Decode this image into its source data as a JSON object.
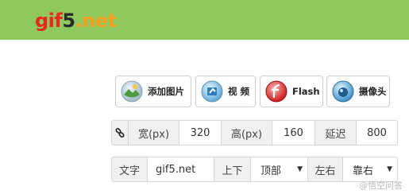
{
  "site": {
    "logo_part1": "gif",
    "logo_part2": "5",
    "logo_part3": ".net"
  },
  "toolbar": {
    "add_image_label": "添加图片",
    "video_label": "视 频",
    "flash_label": "Flash",
    "camera_label": "摄像头"
  },
  "size_row": {
    "width_label": "宽(px)",
    "width_value": "320",
    "height_label": "高(px)",
    "height_value": "160",
    "delay_label": "延迟",
    "delay_value": "800"
  },
  "text_row": {
    "text_label": "文字",
    "text_value": "gif5.net",
    "vertical_label": "上下",
    "vertical_selected": "顶部",
    "horizontal_label": "左右",
    "horizontal_selected": "靠右"
  },
  "watermark": "@悟空问答",
  "colors": {
    "header_bg": "#8fc95e",
    "logo_gif": "#e8261b",
    "logo_5": "#2a2a2a",
    "logo_net": "#f0a020"
  }
}
